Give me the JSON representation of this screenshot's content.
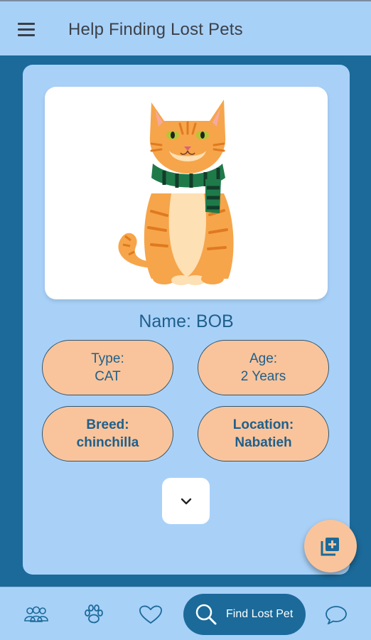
{
  "app_bar": {
    "title": "Help Finding Lost Pets"
  },
  "pet": {
    "name": "Name: BOB",
    "type_label": "Type:",
    "type_value": "CAT",
    "age_label": "Age:",
    "age_value": "2 Years",
    "breed_label": "Breed:",
    "breed_value": "chinchilla",
    "location_label": "Location:",
    "location_value": "Nabatieh"
  },
  "bottom_nav": {
    "items": [
      "people-icon",
      "paw-icon",
      "heart-icon",
      "search-icon",
      "chat-icon"
    ],
    "active_label": "Find Lost Pet"
  },
  "colors": {
    "primary": "#1b6a9a",
    "surface": "#a9d1f8",
    "accent": "#f9c49b"
  }
}
